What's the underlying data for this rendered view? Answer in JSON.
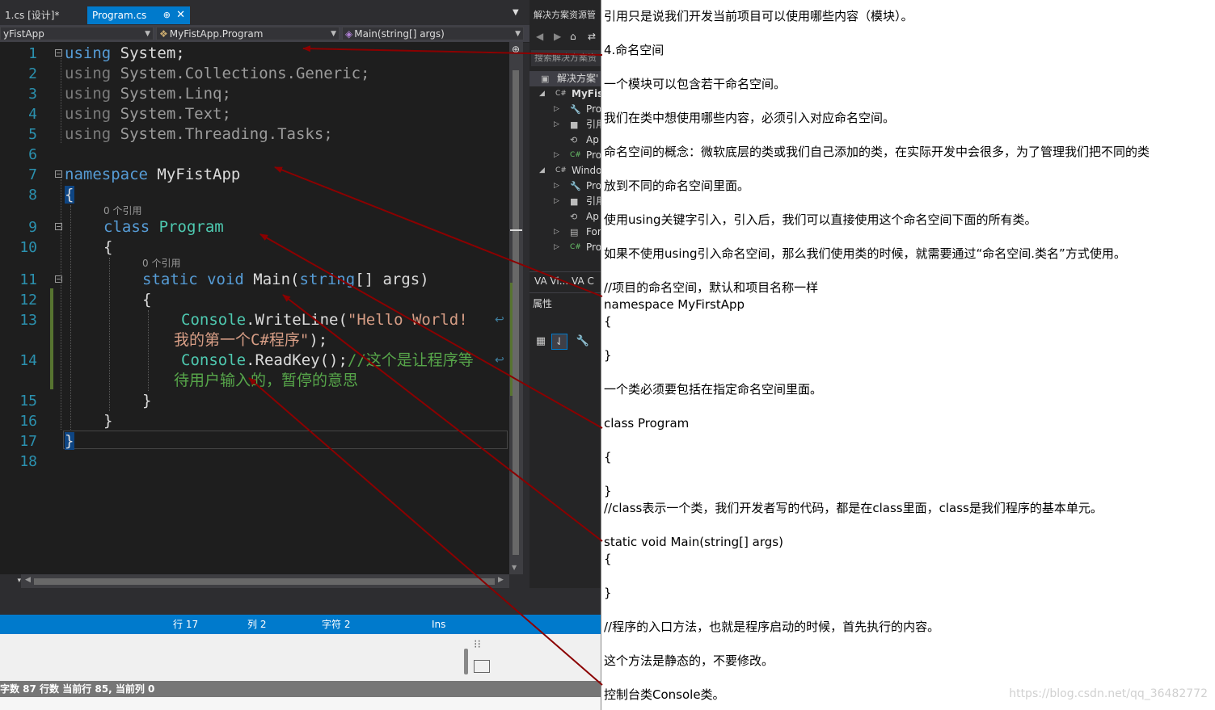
{
  "tabs": [
    {
      "label": "1.cs [设计]*",
      "active": false
    },
    {
      "label": "Program.cs",
      "active": true,
      "pin": "⊕",
      "close": "✕"
    }
  ],
  "navbar": {
    "project": "yFistApp",
    "class": "MyFistApp.Program",
    "method": "Main(string[] args)"
  },
  "editor": {
    "line_numbers": [
      "1",
      "2",
      "3",
      "4",
      "5",
      "6",
      "7",
      "8",
      "9",
      "10",
      "11",
      "12",
      "13",
      "14",
      "15",
      "16",
      "17",
      "18"
    ],
    "codelens": "0 个引用",
    "code": {
      "l1_kw": "using",
      "l1_rest": " System;",
      "l2_kw": "using",
      "l2_rest": " System.Collections.Generic;",
      "l3_kw": "using",
      "l3_rest": " System.Linq;",
      "l4_kw": "using",
      "l4_rest": " System.Text;",
      "l5_kw": "using",
      "l5_rest": " System.Threading.Tasks;",
      "l7_kw": "namespace",
      "l7_rest": " MyFistApp",
      "open_brace": "{",
      "close_brace": "}",
      "l9_kw": "class",
      "l9_ty": "Program",
      "l11_kw1": "static",
      "l11_kw2": "void",
      "l11_rest": " Main(",
      "l11_kw3": "string",
      "l11_rest2": "[] args)",
      "l13_ty": "Console",
      "l13_rest": ".WriteLine(",
      "l13_str": "\"Hello World!",
      "l13b_str": "我的第一个C#程序\"",
      "l13b_rest": ");",
      "l14_ty": "Console",
      "l14_rest": ".ReadKey();",
      "l14_cm": "//这个是让程序等",
      "l14b_cm": "待用户输入的，暂停的意思"
    }
  },
  "status": {
    "row": "行 17",
    "col": "列 2",
    "char": "字符 2",
    "mode": "Ins"
  },
  "word_status": "字数  87 行数  当前行 85, 当前列 0",
  "solution_explorer": {
    "title": "解决方案资源管",
    "search": "搜索解决方案资",
    "items": [
      {
        "label": "解决方案'",
        "icon": "▣",
        "arrow": ""
      },
      {
        "label": "MyFis",
        "icon": "C#",
        "arrow": "◢",
        "bold": true
      },
      {
        "label": "Pro",
        "icon": "🔧",
        "arrow": "▷"
      },
      {
        "label": "引用",
        "icon": "■",
        "arrow": "▷"
      },
      {
        "label": "Ap",
        "icon": "⟲",
        "arrow": ""
      },
      {
        "label": "Pro",
        "icon": "C#",
        "arrow": "▷"
      },
      {
        "label": "Windo",
        "icon": "C#",
        "arrow": "◢"
      },
      {
        "label": "Pro",
        "icon": "🔧",
        "arrow": "▷"
      },
      {
        "label": "引用",
        "icon": "■",
        "arrow": "▷"
      },
      {
        "label": "Ap",
        "icon": "⟲",
        "arrow": ""
      },
      {
        "label": "For",
        "icon": "▤",
        "arrow": "▷"
      },
      {
        "label": "Pro",
        "icon": "C#",
        "arrow": "▷"
      }
    ],
    "va_tabs": "VA Vi...   VA C",
    "properties": "属性"
  },
  "article": {
    "lines": [
      "引用只是说我们开发当前项目可以使用哪些内容（模块）。",
      "4.命名空间",
      "一个模块可以包含若干命名空间。",
      "我们在类中想使用哪些内容，必须引入对应命名空间。",
      "命名空间的概念：微软底层的类或我们自己添加的类，在实际开发中会很多，为了管理我们把不同的类",
      "放到不同的命名空间里面。",
      "使用using关键字引入，引入后，我们可以直接使用这个命名空间下面的所有类。",
      "如果不使用using引入命名空间，那么我们使用类的时候，就需要通过“命名空间.类名”方式使用。",
      "//项目的命名空间，默认和项目名称一样",
      "namespace MyFirstApp",
      "{",
      "}",
      "一个类必须要包括在指定命名空间里面。",
      "class Program",
      "{",
      "}",
      " //class表示一个类，我们开发者写的代码，都是在class里面，class是我们程序的基本单元。",
      " static void Main(string[] args)",
      "{",
      "}",
      "//程序的入口方法，也就是程序启动的时候，首先执行的内容。",
      "这个方法是静态的，不要修改。",
      "控制台类Console类。"
    ],
    "watermark": "https://blog.csdn.net/qq_36482772"
  },
  "colors": {
    "accent": "#007acc",
    "keyword": "#569cd6",
    "type": "#4ec9b0",
    "string": "#d69d85",
    "comment": "#57a64a",
    "arrow": "#8b0000"
  }
}
